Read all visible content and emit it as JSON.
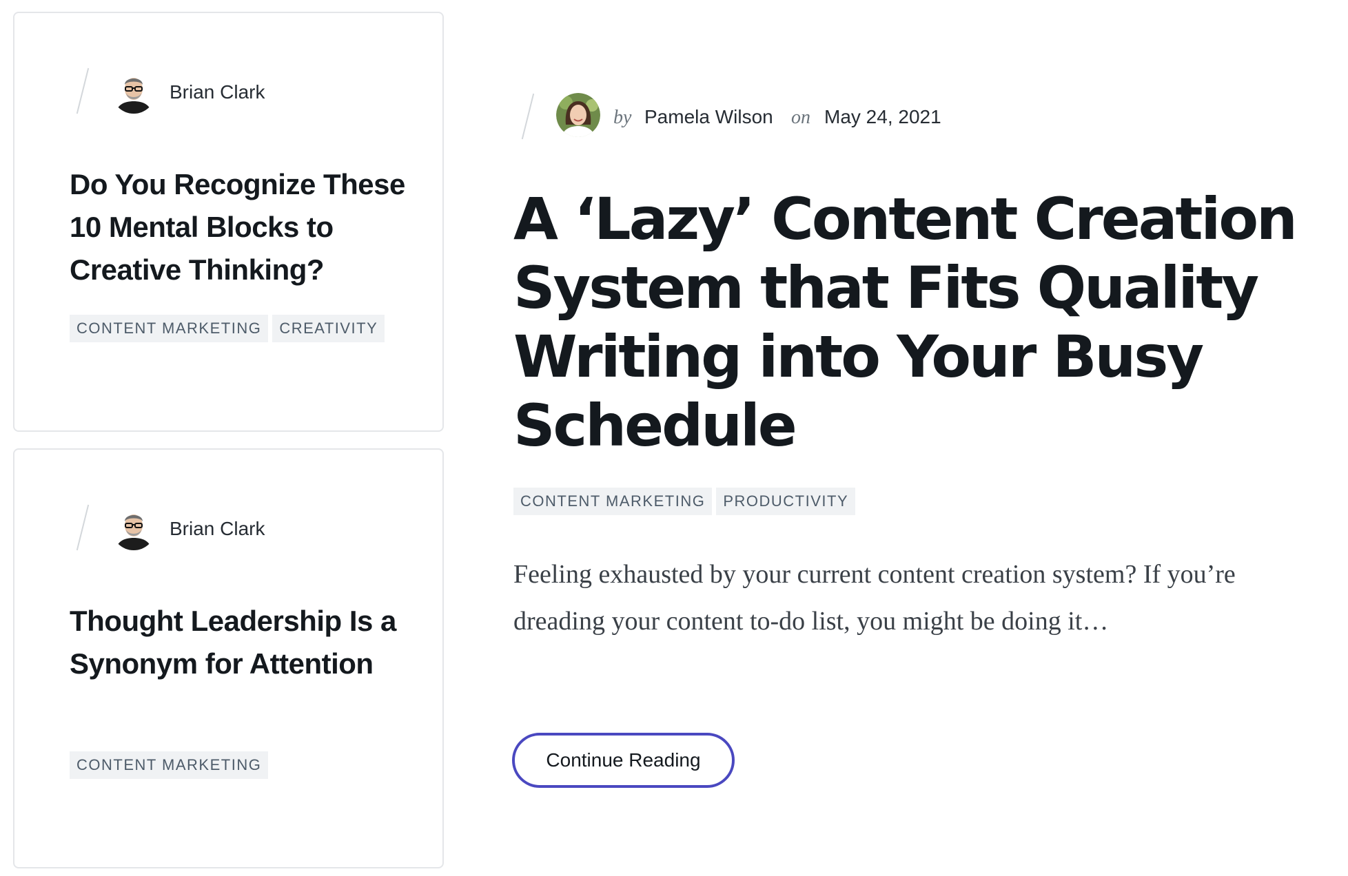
{
  "sidebar_cards": [
    {
      "author": "Brian Clark",
      "title": "Do You Recognize These 10 Mental Blocks to Creative Thinking?",
      "tags": [
        "CONTENT MARKETING",
        "CREATIVITY"
      ]
    },
    {
      "author": "Brian Clark",
      "title": "Thought Leadership Is a Synonym for Attention",
      "tags": [
        "CONTENT MARKETING"
      ]
    }
  ],
  "featured": {
    "by_label": "by",
    "author": "Pamela Wilson",
    "on_label": "on",
    "date": "May 24, 2021",
    "title": "A ‘Lazy’ Content Creation System that Fits Quality Writing into Your Busy Schedule",
    "tags": [
      "CONTENT MARKETING",
      "PRODUCTIVITY"
    ],
    "excerpt": "Feeling exhausted by your current content creation system?  If you’re dreading your content to-do list, you might be doing it…",
    "cta_label": "Continue Reading"
  },
  "colors": {
    "accent": "#4a48c0",
    "tag_bg": "#f0f2f4",
    "tag_text": "#4d5b69",
    "card_border": "#e4e6e9"
  }
}
